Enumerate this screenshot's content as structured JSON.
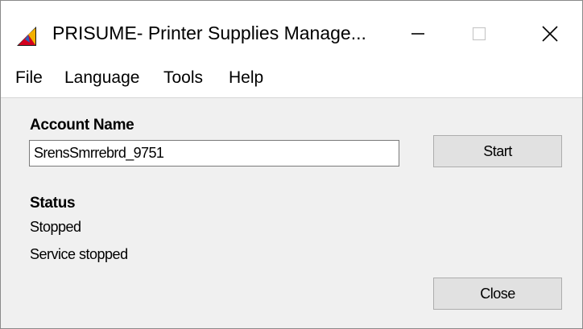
{
  "window": {
    "title": "PRISUME- Printer Supplies Manage..."
  },
  "menu": {
    "items": [
      "File",
      "Language",
      "Tools",
      "Help"
    ]
  },
  "form": {
    "account_label": "Account Name",
    "account_value": "SrensSmrrebrd_9751",
    "start_label": "Start",
    "status_label": "Status",
    "status_value": "Stopped",
    "status_detail": "Service stopped",
    "close_label": "Close"
  },
  "icons": {
    "app": "printer-supplies-app-icon",
    "minimize": "minimize-icon",
    "maximize": "maximize-icon",
    "close": "close-icon"
  },
  "colors": {
    "dialog_bg": "#f0f0f0",
    "button_bg": "#e1e1e1",
    "titlebar_bg": "#ffffff"
  }
}
